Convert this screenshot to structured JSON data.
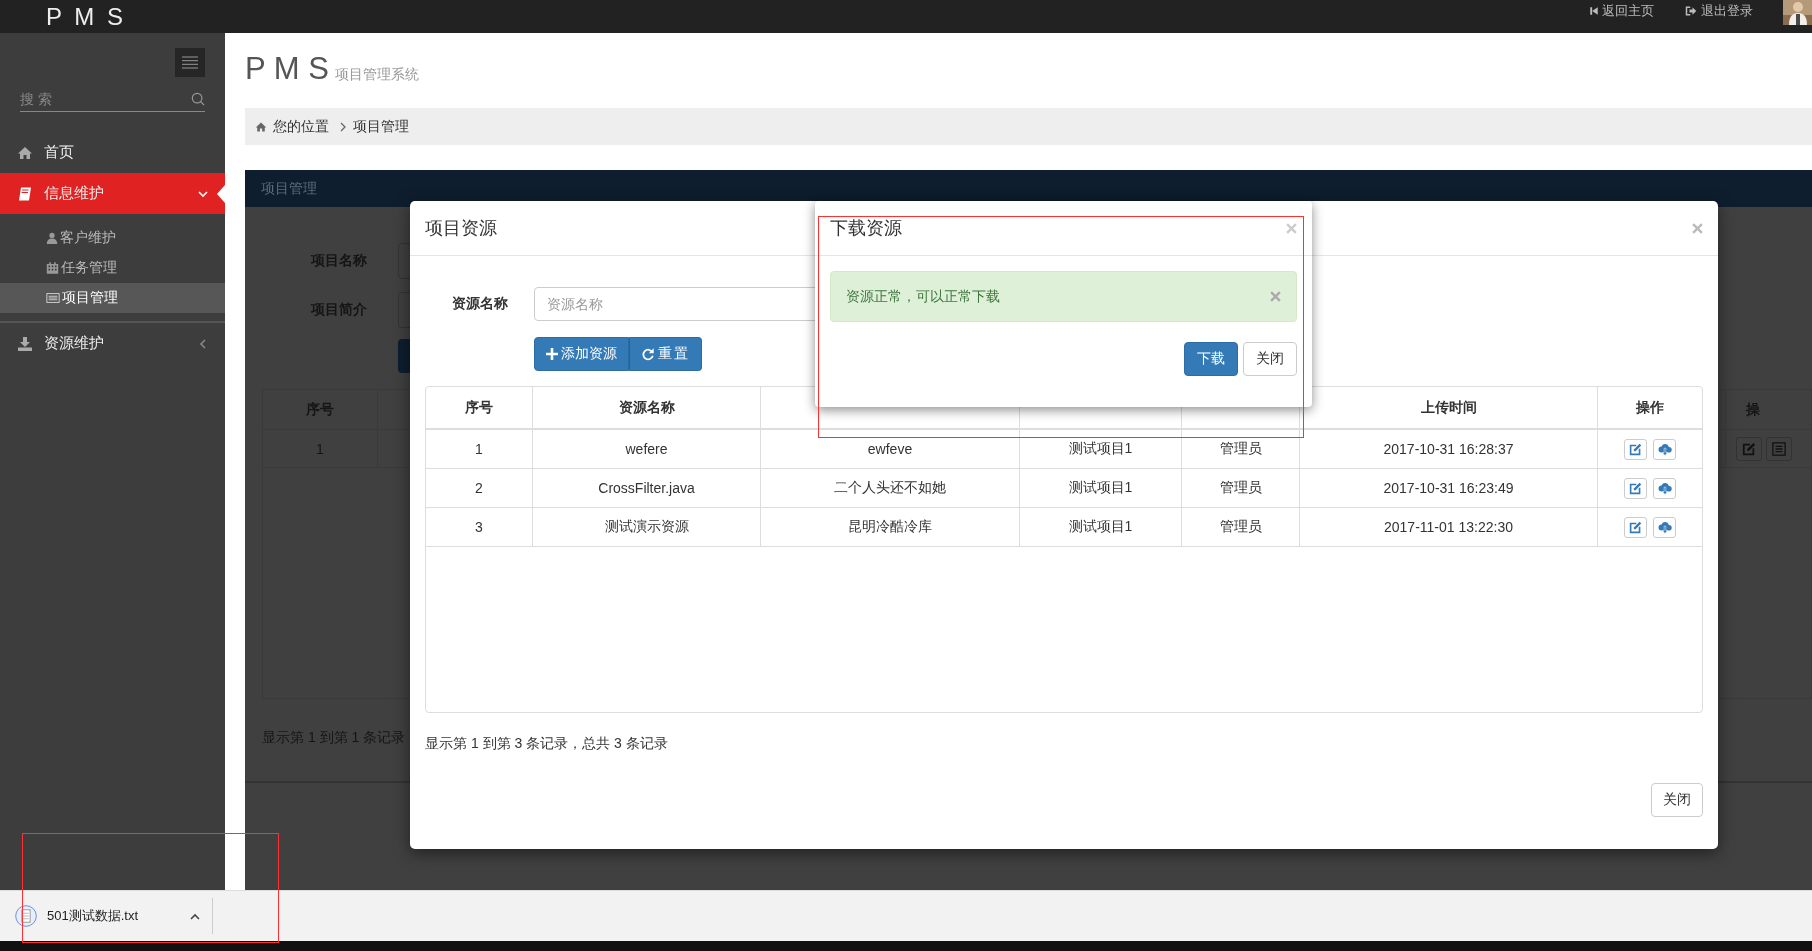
{
  "top_bar": {
    "logo": "P M S",
    "links": [
      "返回主页",
      "退出登录"
    ]
  },
  "sidebar": {
    "search": {
      "placeholder": "搜 索"
    },
    "items": [
      {
        "label": "首页",
        "kind": "link",
        "selected": false
      },
      {
        "label": "信息维护",
        "kind": "group",
        "selected": true,
        "expanded": true,
        "children": [
          {
            "label": "客户维护",
            "selected": false
          },
          {
            "label": "任务管理",
            "selected": false
          },
          {
            "label": "项目管理",
            "selected": true
          }
        ]
      },
      {
        "label": "资源维护",
        "kind": "group",
        "selected": false,
        "expanded": false
      }
    ]
  },
  "header": {
    "title": "P M S",
    "subtitle": "项目管理系统"
  },
  "breadcrumb": [
    "您的位置",
    "项目管理"
  ],
  "panel": {
    "title": "项目管理",
    "form_labels": [
      "项目名称",
      "项目简介"
    ],
    "table": {
      "columns": [
        "序号",
        "操"
      ],
      "rows": [
        [
          "1"
        ]
      ]
    },
    "footer": "显示第 1 到第 1 条记录"
  },
  "modal": {
    "title": "项目资源",
    "field": {
      "label": "资源名称",
      "placeholder": "资源名称"
    },
    "buttons": [
      "添加资源",
      "重置"
    ],
    "table": {
      "columns": [
        {
          "label": "序号"
        },
        {
          "label": "资源名称"
        },
        {},
        {},
        {},
        {
          "label": "上传时间"
        },
        {
          "label": "操作"
        }
      ],
      "rows": [
        [
          "1",
          "wefere",
          "ewfeve",
          "测试项目1",
          "管理员",
          "2017-10-31 16:28:37"
        ],
        [
          "2",
          "CrossFilter.java",
          "二个人头还不如她",
          "测试项目1",
          "管理员",
          "2017-10-31 16:23:49"
        ],
        [
          "3",
          "测试演示资源",
          "昆明冷酷冷库",
          "测试项目1",
          "管理员",
          "2017-11-01 13:22:30"
        ]
      ]
    },
    "footer": "显示第 1 到第 3 条记录，总共 3 条记录",
    "close_button": "关闭"
  },
  "dialog": {
    "title": "下载资源",
    "alert": "资源正常，可以正常下载",
    "buttons": [
      {
        "label": "下载",
        "kind": "primary"
      },
      {
        "label": "关闭",
        "kind": "default"
      }
    ]
  },
  "download_bar": {
    "file": "501测试数据.txt"
  }
}
